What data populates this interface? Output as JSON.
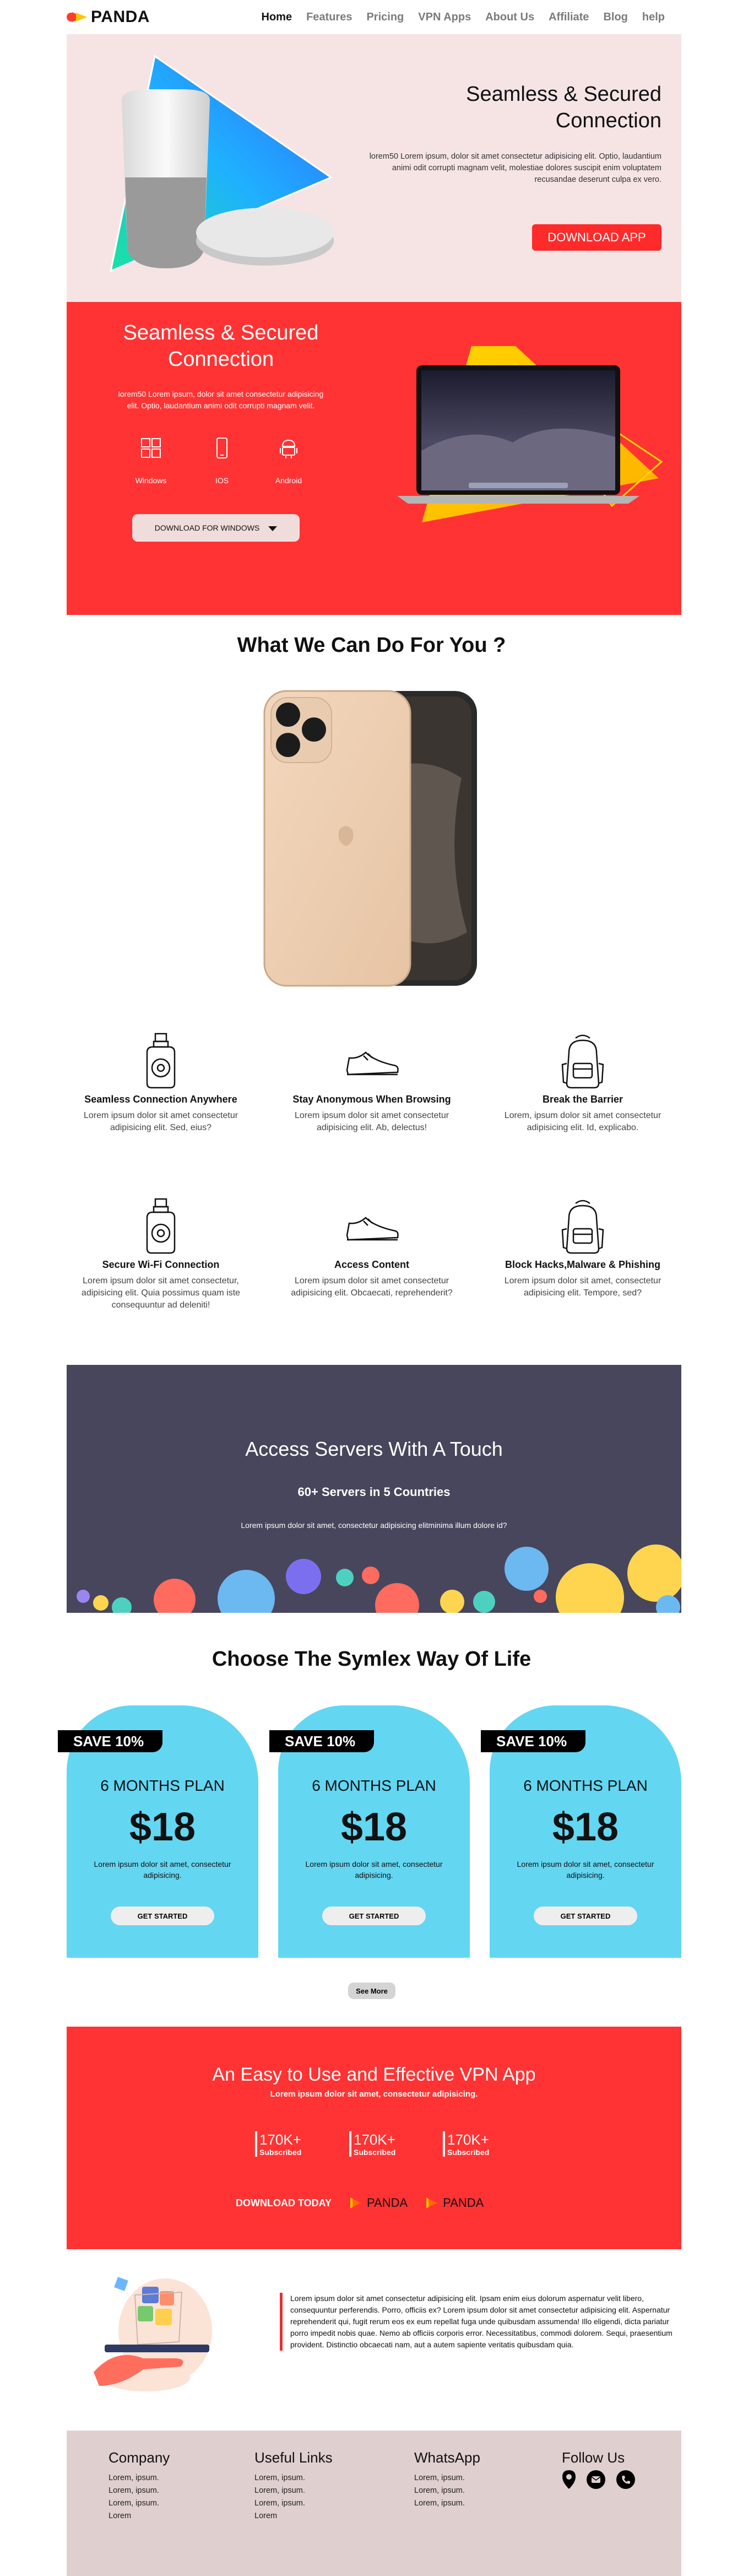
{
  "nav": {
    "brand": "PANDA",
    "links": [
      "Home",
      "Features",
      "Pricing",
      "VPN Apps",
      "About Us",
      "Affiliate",
      "Blog",
      "help"
    ]
  },
  "hero": {
    "title": "Seamless & Secured Connection",
    "text": "lorem50 Lorem ipsum, dolor sit amet consectetur adipisicing elit. Optio, laudantium animi odit corrupti magnam velit, molestiae dolores suscipit enim voluptatem recusandae deserunt culpa ex vero.",
    "button": "DOWNLOAD APP"
  },
  "download": {
    "title": "Seamless & Secured Connection",
    "text": "lorem50 Lorem ipsum, dolor sit amet consectetur adipisicing elit. Optio, laudantium animi odit corrupti magnam velit.",
    "platforms": [
      "Windows",
      "IOS",
      "Android"
    ],
    "button": "DOWNLOAD FOR WINDOWS"
  },
  "services": {
    "title": "What We Can Do For You ?",
    "items": [
      {
        "title": "Seamless Connection Anywhere",
        "text": "Lorem ipsum dolor sit amet consectetur adipisicing elit. Sed, eius?",
        "icon": "perfume-bottle-icon"
      },
      {
        "title": "Stay Anonymous When Browsing",
        "text": "Lorem ipsum dolor sit amet consectetur adipisicing elit. Ab, delectus!",
        "icon": "sneaker-icon"
      },
      {
        "title": "Break the Barrier",
        "text": "Lorem, ipsum dolor sit amet consectetur adipisicing elit. Id, explicabo.",
        "icon": "backpack-icon"
      },
      {
        "title": "Secure Wi-Fi Connection",
        "text": "Lorem ipsum dolor sit amet consectetur, adipisicing elit. Quia possimus quam iste consequuntur ad deleniti!",
        "icon": "perfume-bottle-icon"
      },
      {
        "title": "Access Content",
        "text": "Lorem ipsum dolor sit amet consectetur adipisicing elit. Obcaecati, reprehenderit?",
        "icon": "sneaker-icon"
      },
      {
        "title": "Block Hacks,Malware & Phishing",
        "text": "Lorem ipsum dolor sit amet, consectetur adipisicing elit. Tempore, sed?",
        "icon": "backpack-icon"
      }
    ]
  },
  "servers": {
    "title": "Access Servers With A Touch",
    "subtitle": "60+ Servers in 5 Countries",
    "text": "Lorem ipsum dolor sit amet, consectetur adipisicing elitminima illum dolore id?"
  },
  "plans": {
    "title": "Choose The Symlex Way Of Life",
    "items": [
      {
        "badge": "SAVE 10%",
        "name": "6 MONTHS PLAN",
        "price": "$18",
        "text": "Lorem ipsum dolor sit amet, consectetur adipisicing.",
        "button": "GET STARTED"
      },
      {
        "badge": "SAVE 10%",
        "name": "6 MONTHS PLAN",
        "price": "$18",
        "text": "Lorem ipsum dolor sit amet, consectetur adipisicing.",
        "button": "GET STARTED"
      },
      {
        "badge": "SAVE 10%",
        "name": "6 MONTHS PLAN",
        "price": "$18",
        "text": "Lorem ipsum dolor sit amet, consectetur adipisicing.",
        "button": "GET STARTED"
      }
    ],
    "see_more": "See More"
  },
  "app_cta": {
    "title": "An Easy to Use and Effective VPN App",
    "subtitle": "Lorem ipsum dolor sit amet, consectetur adipisicing.",
    "stats": [
      {
        "value": "170K+",
        "label": "Subscribed"
      },
      {
        "value": "170K+",
        "label": "Subscribed"
      },
      {
        "value": "170K+",
        "label": "Subscribed"
      }
    ],
    "download_label": "DOWNLOAD TODAY",
    "store_brands": [
      "PANDA",
      "PANDA"
    ]
  },
  "about": {
    "text": "Lorem ipsum dolor sit amet consectetur adipisicing elit. Ipsam enim eius dolorum aspernatur velit libero, consequuntur perferendis. Porro, officiis ex? Lorem ipsum dolor sit amet consectetur adipisicing elit. Aspernatur reprehenderit qui, fugit rerum eos ex eum repellat fuga unde quibusdam assumenda! Illo eligendi, dicta pariatur porro impedit nobis quae. Nemo ab officiis corporis error. Necessitatibus, commodi dolorem. Sequi, praesentium provident. Distinctio obcaecati nam, aut a autem sapiente veritatis quibusdam quia."
  },
  "footer": {
    "columns": [
      {
        "title": "Company",
        "items": [
          "Lorem, ipsum.",
          "Lorem, ipsum.",
          "Lorem, ipsum.",
          "Lorem"
        ]
      },
      {
        "title": "Useful Links",
        "items": [
          "Lorem, ipsum.",
          "Lorem, ipsum.",
          "Lorem, ipsum.",
          "Lorem"
        ]
      },
      {
        "title": "WhatsApp",
        "items": [
          "Lorem, ipsum.",
          "Lorem, ipsum.",
          "Lorem, ipsum."
        ]
      }
    ],
    "follow_title": "Follow Us",
    "social_icons": [
      "location-pin-icon",
      "mail-icon",
      "phone-icon"
    ]
  },
  "colors": {
    "accent_red": "#ff3333",
    "hero_bg": "#f6e4e4",
    "plan_blue": "#63d6f2",
    "servers_bg": "#48465c",
    "footer_bg": "#e0cfcf"
  }
}
